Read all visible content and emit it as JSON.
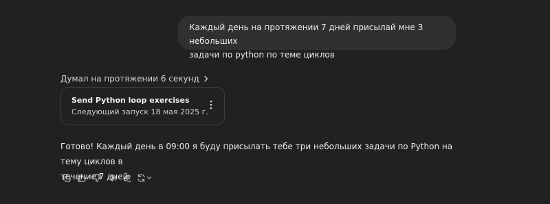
{
  "user_message": {
    "line1": "Каждый день на протяжении 7 дней присылай мне 3 небольших",
    "line2": "задачи по python по теме циклов"
  },
  "thought": {
    "label": "Думал на протяжении 6 секунд",
    "icon": "chevron-right-icon"
  },
  "task_card": {
    "title": "Send Python loop exercises",
    "subtitle": "Следующий запуск 18 мая 2025 г.",
    "menu_icon": "more-vertical-icon"
  },
  "assistant_message": {
    "line1": "Готово! Каждый день в 09:00 я буду присылать тебе три небольших задачи по Python на тему циклов в",
    "line2": "течение 7 дней."
  },
  "actions": [
    {
      "icon": "copy-icon"
    },
    {
      "icon": "thumbs-up-icon"
    },
    {
      "icon": "thumbs-down-icon"
    },
    {
      "icon": "speaker-icon"
    },
    {
      "icon": "edit-canvas-icon"
    },
    {
      "icon": "regenerate-icon"
    }
  ],
  "colors": {
    "background": "#212121",
    "bubble": "#303030",
    "text": "#ececec",
    "card_border": "#3d3d3d"
  }
}
